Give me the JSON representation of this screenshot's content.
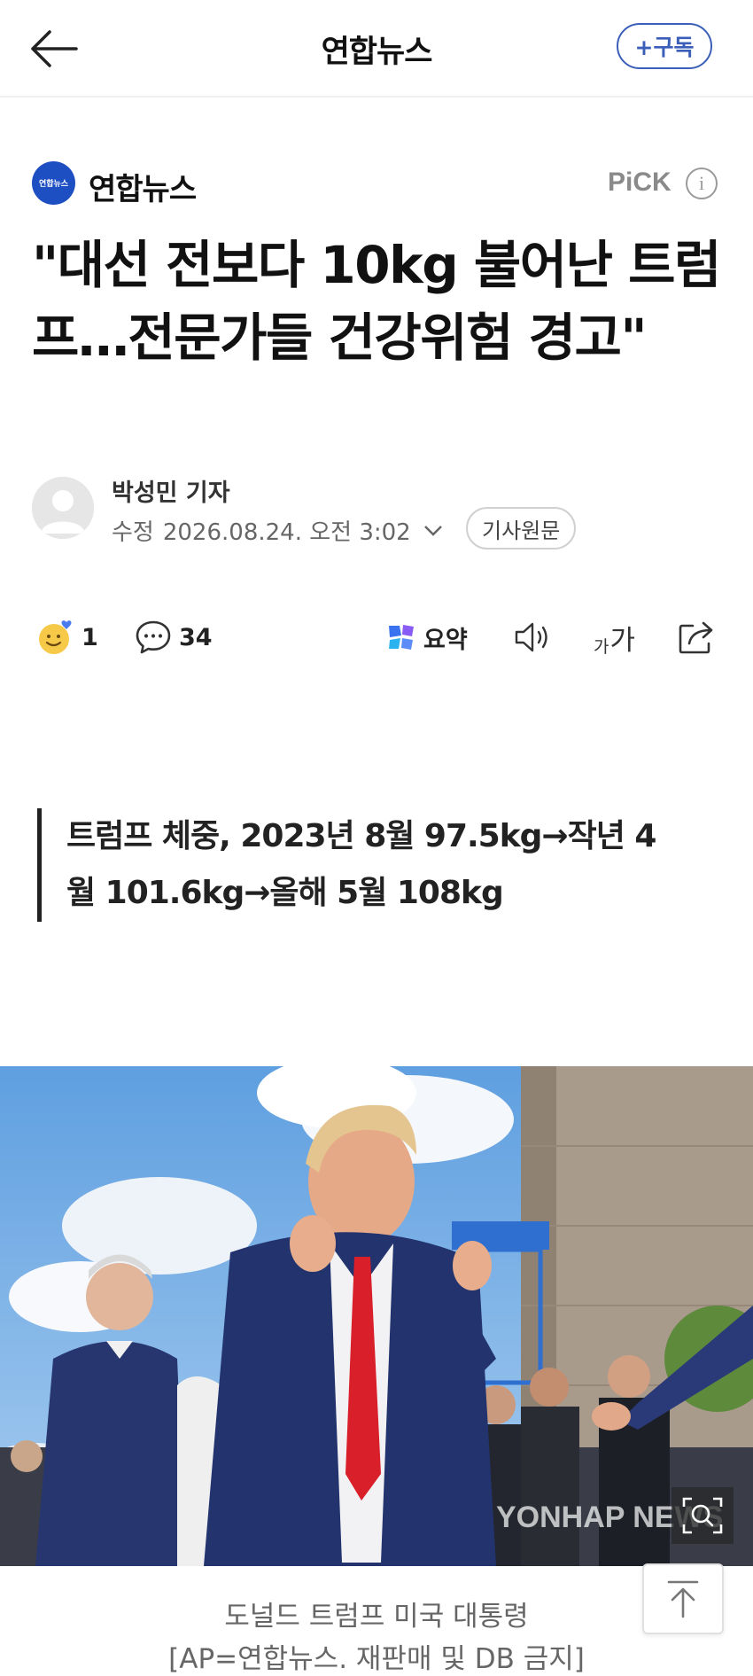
{
  "topbar": {
    "title": "연합뉴스",
    "subscribe_label": "+구독",
    "back_icon": "arrow-left-icon"
  },
  "press": {
    "logo_text": "연합뉴스",
    "name": "연합뉴스",
    "pick_label": "PiCK",
    "info_icon": "info-icon",
    "brand_color": "#1e4fc2"
  },
  "article": {
    "headline": "\"대선 전보다 10kg 불어난 트럼프…전문가들 건강위험 경고\"",
    "reporter": "박성민 기자",
    "modified_label": "수정",
    "modified_time": "2026.08.24. 오전 3:02",
    "original_label": "기사원문",
    "subheading": "트럼프 체중, 2023년 8월 97.5kg→작년 4월 101.6kg→올해 5월 108kg",
    "caption_line1": "도널드 트럼프 미국 대통령",
    "caption_line2": "[AP=연합뉴스. 재판매 및 DB 금지]",
    "watermark": "YONHAP NEWS"
  },
  "actions": {
    "reaction_count": "1",
    "comment_count": "34",
    "summary_label": "요약",
    "font_small": "가",
    "font_large": "가",
    "icons": [
      "reaction-emoji-icon",
      "comment-icon",
      "summary-icon",
      "speaker-icon",
      "font-size-icon",
      "share-icon"
    ]
  }
}
